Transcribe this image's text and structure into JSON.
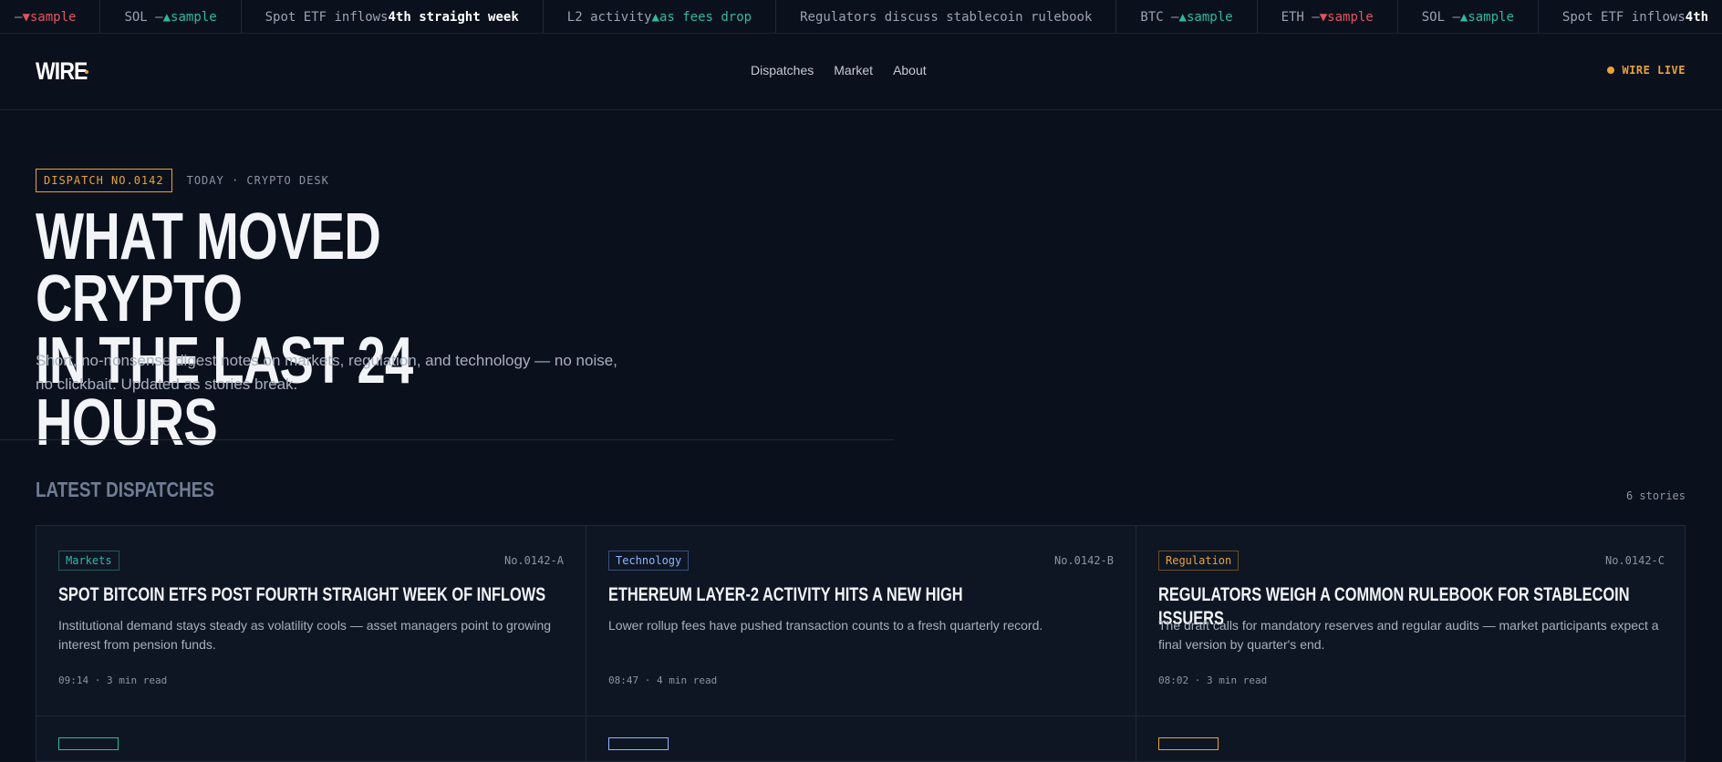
{
  "ticker": [
    {
      "prefix": "— ",
      "trend": "down",
      "arrow": "▼",
      "text": " sample"
    },
    {
      "prefix": "SOL — ",
      "trend": "up",
      "arrow": "▲",
      "text": " sample"
    },
    {
      "plain": "Spot ETF inflows ",
      "bold": "4th straight week"
    },
    {
      "plain": "L2 activity ",
      "trend": "up",
      "arrow": "▲",
      "text": " as fees drop"
    },
    {
      "plain": "Regulators discuss stablecoin rulebook"
    },
    {
      "prefix": "BTC — ",
      "trend": "up",
      "arrow": "▲",
      "text": " sample"
    },
    {
      "prefix": "ETH — ",
      "trend": "down",
      "arrow": "▼",
      "text": " sample"
    },
    {
      "prefix": "SOL — ",
      "trend": "up",
      "arrow": "▲",
      "text": " sample"
    },
    {
      "plain": "Spot ETF inflows ",
      "bold": "4th"
    }
  ],
  "header": {
    "logo": "WIRE",
    "nav": [
      "Dispatches",
      "Market",
      "About"
    ],
    "live_label": "WIRE LIVE"
  },
  "hero": {
    "badge": "DISPATCH NO.0142",
    "meta": "TODAY · CRYPTO DESK",
    "title_line1": "WHAT MOVED CRYPTO",
    "title_line2": "IN THE LAST 24 HOURS",
    "description": "Short, no-nonsense digest notes on markets, regulation, and technology — no noise, no clickbait. Updated as stories break."
  },
  "section": {
    "title": "LATEST DISPATCHES",
    "count": "6 stories"
  },
  "cards": [
    {
      "tag": "Markets",
      "tag_kind": "markets",
      "number": "No.0142-A",
      "title": "SPOT BITCOIN ETFS POST FOURTH STRAIGHT WEEK OF INFLOWS",
      "description": "Institutional demand stays steady as volatility cools — asset managers point to growing interest from pension funds.",
      "meta": "09:14 · 3 min read"
    },
    {
      "tag": "Technology",
      "tag_kind": "tech",
      "number": "No.0142-B",
      "title": "ETHEREUM LAYER-2 ACTIVITY HITS A NEW HIGH",
      "description": "Lower rollup fees have pushed transaction counts to a fresh quarterly record.",
      "meta": "08:47 · 4 min read"
    },
    {
      "tag": "Regulation",
      "tag_kind": "reg",
      "number": "No.0142-C",
      "title": "REGULATORS WEIGH A COMMON RULEBOOK FOR STABLECOIN ISSUERS",
      "description": "The draft calls for mandatory reserves and regular audits — market participants expect a final version by quarter's end.",
      "meta": "08:02 · 3 min read"
    }
  ],
  "colors": {
    "background": "#0b111c",
    "accent": "#e8a23a",
    "up": "#2fb8a0",
    "down": "#e2535f",
    "tech": "#8fb4ff"
  }
}
